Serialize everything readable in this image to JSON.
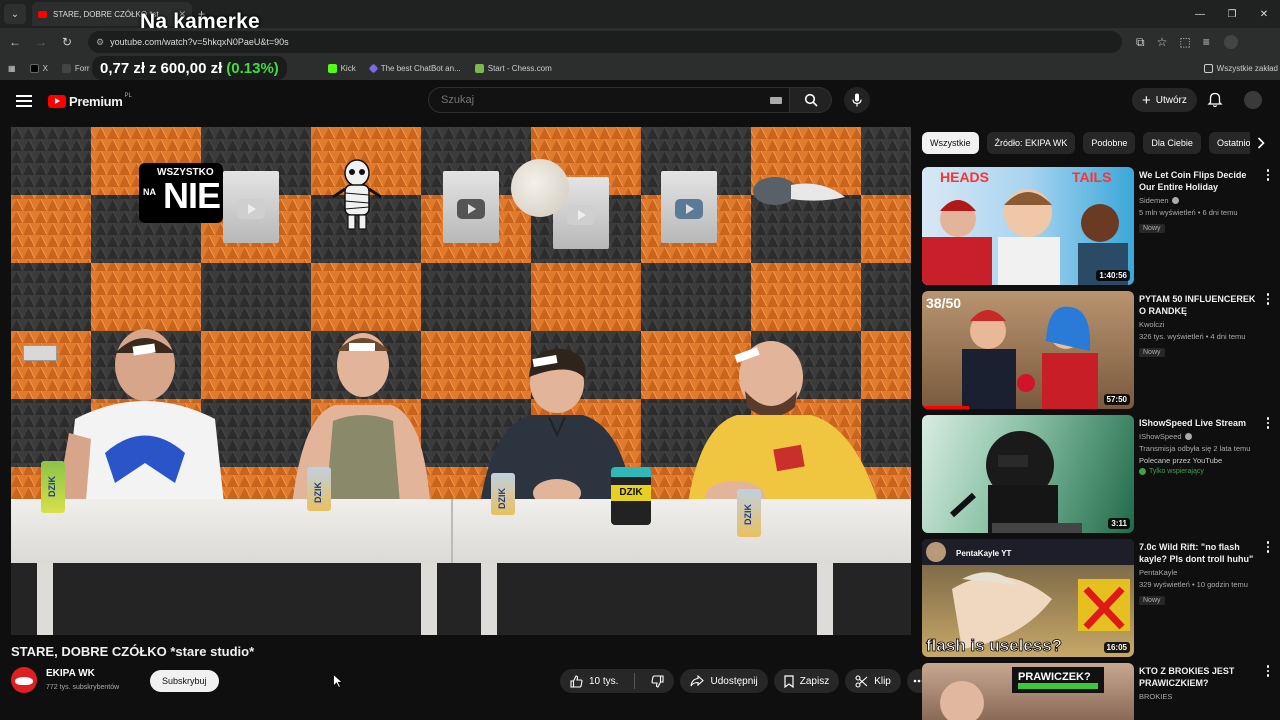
{
  "overlay": {
    "title": "Na kamerke",
    "price": "0,77 zł",
    "separator": "z",
    "total": "600,00 zł",
    "percent": "(0.13%)"
  },
  "browser": {
    "tab_title": "STARE, DOBRE CZÓŁKO *st",
    "url": "youtube.com/watch?v=5hkqxN0PaeU&t=90s",
    "bookmarks": [
      {
        "label": "X",
        "color": "#000000"
      },
      {
        "label": "Forr",
        "color": "#444444"
      },
      {
        "label": "Kick",
        "color": "#53fc18"
      },
      {
        "label": "The best ChatBot an...",
        "color": "#7b68ee"
      },
      {
        "label": "Start - Chess.com",
        "color": "#81b64c"
      }
    ],
    "bookmarks_folder": "Wszystkie zakład"
  },
  "header": {
    "logo_text": "Premium",
    "logo_country": "PL",
    "search_placeholder": "Szukaj",
    "create_label": "Utwórz"
  },
  "video": {
    "title": "STARE, DOBRE CZÓŁKO *stare studio*",
    "channel": "EKIPA WK",
    "subscribers": "772 tys. subskrybentów",
    "subscribe_label": "Subskrybuj",
    "likes": "10 tys.",
    "share_label": "Udostępnij",
    "save_label": "Zapisz",
    "clip_label": "Klip",
    "sign_line1": "WSZYSTKO",
    "sign_line2": "NA",
    "sign_line3": "NIE",
    "can_label": "DZIK",
    "tub_label": "DZIK"
  },
  "chips": [
    "Wszystkie",
    "Źródło: EKIPA WK",
    "Podobne",
    "Dla Ciebie",
    "Ostatnio"
  ],
  "recommendations": [
    {
      "title": "We Let Coin Flips Decide Our Entire Holiday",
      "channel": "Sidemen",
      "verified": true,
      "meta": "5 mln wyświetleń • 6 dni temu",
      "badge": "Nowy",
      "duration": "1:40:56",
      "thumb_text_left": "HEADS",
      "thumb_text_right": "TAILS"
    },
    {
      "title": "PYTAM 50 INFLUENCEREK O RANDKĘ",
      "channel": "Kwolczi",
      "verified": false,
      "meta": "326 tys. wyświetleń • 4 dni temu",
      "badge": "Nowy",
      "duration": "57:50",
      "thumb_text_left": "38/50",
      "watched": 0.22
    },
    {
      "title": "IShowSpeed Live Stream",
      "channel": "IShowSpeed",
      "verified": true,
      "meta": "Transmisja odbyła się 2 lata temu",
      "promo": "Polecane przez YouTube",
      "members": "Tylko wspierający",
      "duration": "3:11"
    },
    {
      "title": "7.0c Wild Rift: \"no flash kayle? Pls dont troll huhu\"",
      "channel": "PentaKayle",
      "verified": false,
      "meta": "329 wyświetleń • 10 godzin temu",
      "badge": "Nowy",
      "duration": "16:05",
      "thumb_text_left": "flash is useless?",
      "thumb_header": "PentaKayle YT"
    },
    {
      "title": "KTO Z BROKIES JEST PRAWICZKIEM?",
      "channel": "BROKIES",
      "verified": false,
      "meta": "",
      "thumb_text_left": "PRAWICZEK?"
    }
  ]
}
